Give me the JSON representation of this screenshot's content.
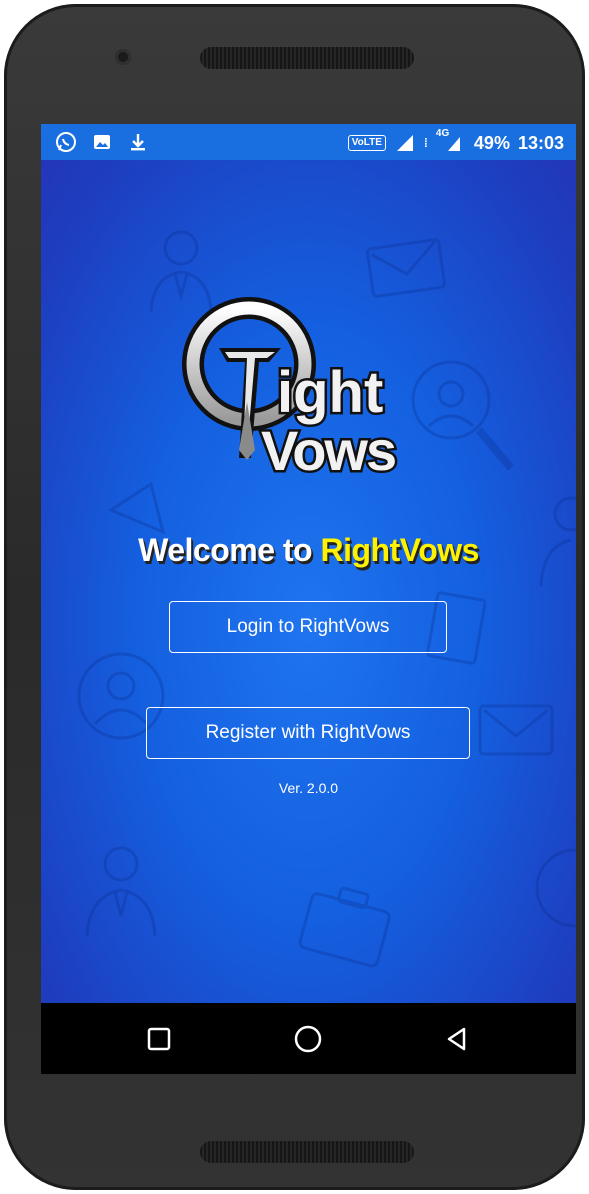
{
  "statusbar": {
    "left_icons": [
      "whatsapp-icon",
      "image-icon",
      "download-icon"
    ],
    "volte": "VoLTE",
    "network": "4G",
    "battery": "49%",
    "time": "13:03",
    "color": "#1a6fe0"
  },
  "app": {
    "logo_line1": "Right",
    "logo_line2": "Vows",
    "welcome_prefix": "Welcome to ",
    "welcome_brand": "RightVows",
    "login_label": "Login to RightVows",
    "register_label": "Register with RightVows",
    "version": "Ver. 2.0.0",
    "brand_color": "#fff200"
  },
  "navbar": {
    "icons": [
      "recent-apps-icon",
      "home-icon",
      "back-icon"
    ]
  }
}
